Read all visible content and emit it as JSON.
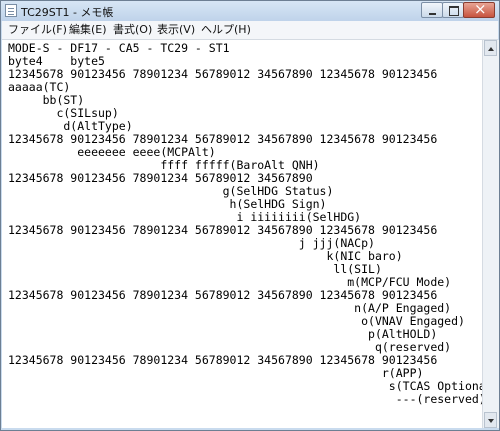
{
  "window": {
    "title": "TC29ST1 - メモ帳"
  },
  "menu": [
    {
      "label": "ファイル(F)"
    },
    {
      "label": "編集(E)"
    },
    {
      "label": "書式(O)"
    },
    {
      "label": "表示(V)"
    },
    {
      "label": "ヘルプ(H)"
    }
  ],
  "document": {
    "lines": [
      "MODE-S - DF17 - CA5 - TC29 - ST1",
      "byte4    byte5",
      "12345678 90123456 78901234 56789012 34567890 12345678 90123456",
      "aaaaa(TC)",
      "     bb(ST)",
      "       c(SILsup)",
      "        d(AltType)",
      "12345678 90123456 78901234 56789012 34567890 12345678 90123456",
      "          eeeeeee eeee(MCPAlt)",
      "                      ffff fffff(BaroAlt QNH)",
      "12345678 90123456 78901234 56789012 34567890",
      "                               g(SelHDG Status)",
      "                                h(SelHDG Sign)",
      "                                 i iiiiiiii(SelHDG)",
      "12345678 90123456 78901234 56789012 34567890 12345678 90123456",
      "                                          j jjj(NACp)",
      "                                              k(NIC baro)",
      "                                               ll(SIL)",
      "                                                 m(MCP/FCU Mode)",
      "12345678 90123456 78901234 56789012 34567890 12345678 90123456",
      "                                                  n(A/P Engaged)",
      "                                                   o(VNAV Engaged)",
      "                                                    p(AltHOLD)",
      "                                                     q(reserved)",
      "12345678 90123456 78901234 56789012 34567890 12345678 90123456",
      "                                                      r(APP)",
      "                                                       s(TCAS Optional)",
      "                                                        ---(reserved)"
    ]
  },
  "icons": {
    "app": "notepad-icon",
    "minimize": "minimize-icon",
    "maximize": "maximize-icon",
    "close": "close-icon"
  }
}
